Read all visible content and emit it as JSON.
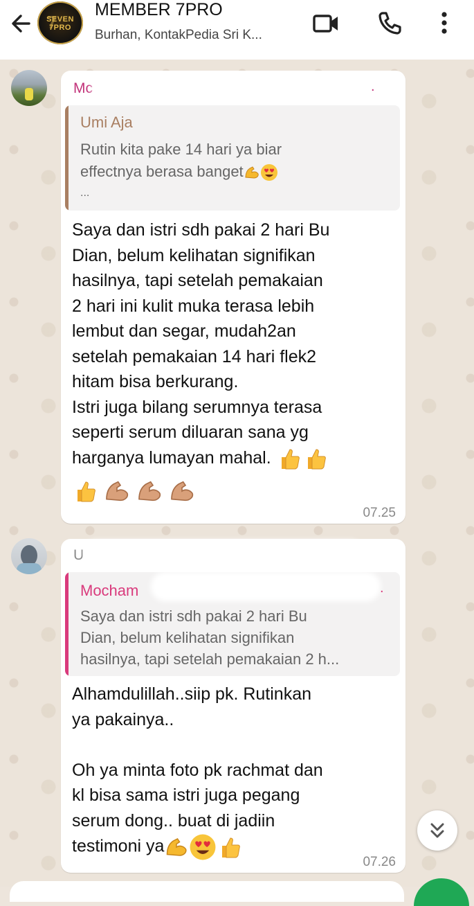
{
  "header": {
    "title": "MEMBER 7PRO",
    "subtitle": "Burhan, KontakPedia Sri K...",
    "avatar_text": "SEVEN 7PRO"
  },
  "messages": [
    {
      "sender": "Mc",
      "quote": {
        "name": "Umi Aja",
        "text_lines": [
          "Rutin kita pake 14 hari ya biar",
          "effectnya berasa banget"
        ],
        "ellipsis": "..."
      },
      "lines": [
        "Saya dan istri sdh pakai 2 hari Bu",
        "Dian, belum kelihatan signifikan",
        "hasilnya, tapi setelah pemakaian",
        "2 hari ini kulit muka terasa lebih",
        "lembut dan segar, mudah2an",
        "setelah pemakaian 14 hari flek2",
        "hitam bisa berkurang.",
        "Istri juga bilang serumnya terasa",
        "seperti serum diluaran sana yg",
        "harganya lumayan mahal."
      ],
      "time": "07.25"
    },
    {
      "sender": "U",
      "quote": {
        "name": "Mocham",
        "text_lines": [
          "Saya dan istri sdh pakai 2 hari Bu",
          "Dian, belum kelihatan signifikan",
          "hasilnya, tapi setelah pemakaian 2 h..."
        ]
      },
      "lines": [
        "Alhamdulillah..siip pk.  Rutinkan",
        "ya pakainya..",
        "",
        "Oh ya minta foto pk rachmat dan",
        "kl bisa sama istri juga pegang",
        "serum dong.. buat di jadiin",
        "testimoni ya"
      ],
      "time": "07.26"
    }
  ],
  "colors": {
    "sender_pink": "#c2337a",
    "quote_brown": "#a97f62",
    "quote_pink": "#d93a7c",
    "chat_background": "#ece4da",
    "fab_green": "#1fa855"
  },
  "icons": {
    "back": "arrow-left-icon",
    "video": "video-camera-icon",
    "call": "phone-icon",
    "menu": "more-vertical-icon",
    "scroll": "double-chevron-down-icon",
    "emojis": [
      "flexed-biceps",
      "heart-eyes",
      "thumbs-up"
    ]
  }
}
